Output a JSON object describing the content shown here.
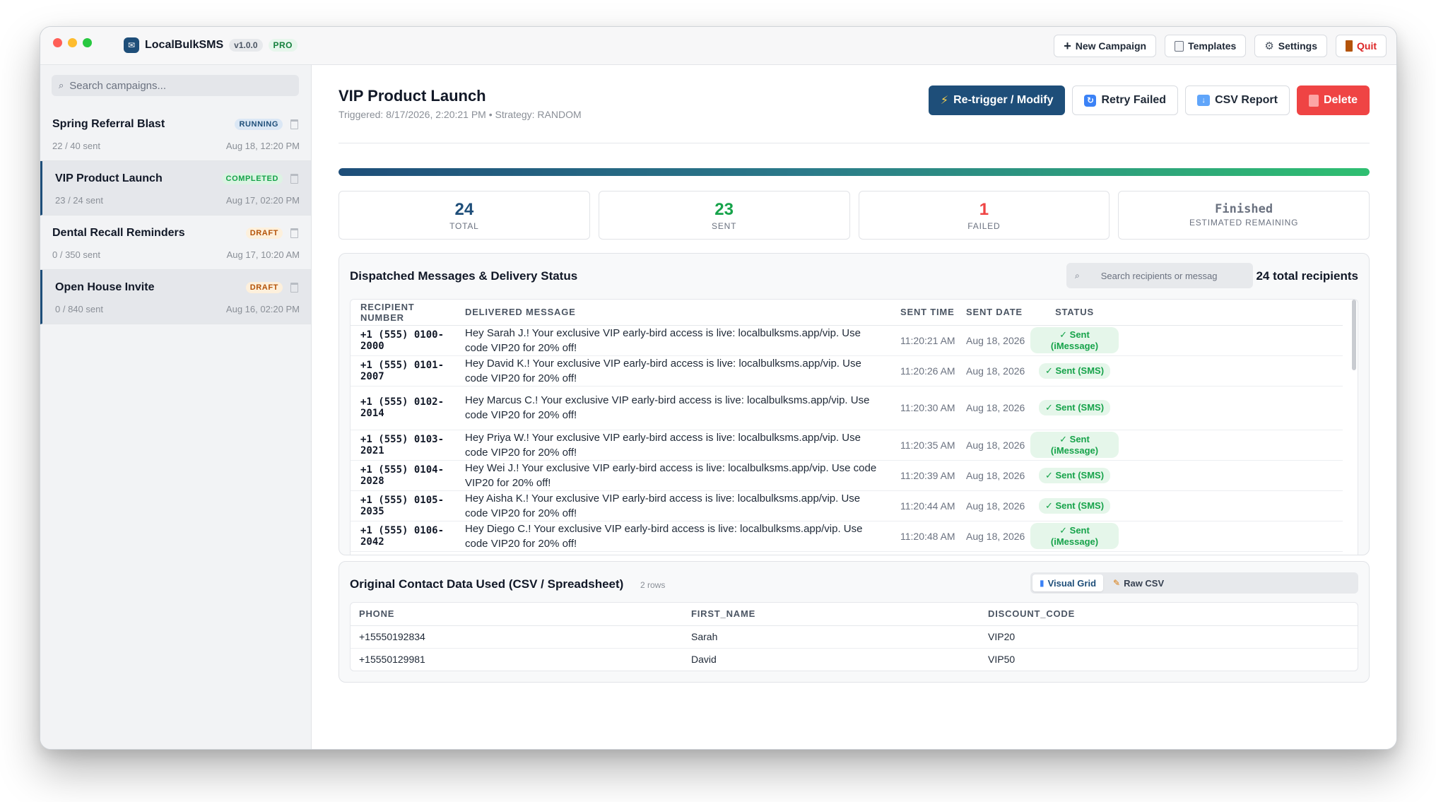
{
  "app": {
    "name": "LocalBulkSMS",
    "version": "v1.0.0",
    "tier": "PRO"
  },
  "topbar": {
    "new_campaign": "New Campaign",
    "templates": "Templates",
    "settings": "Settings",
    "quit": "Quit"
  },
  "sidebar": {
    "search_placeholder": "Search campaigns...",
    "campaigns": [
      {
        "name": "Spring Referral Blast",
        "status": "RUNNING",
        "sent": "22 / 40 sent",
        "date": "Aug 18, 12:20 PM"
      },
      {
        "name": "VIP Product Launch",
        "status": "COMPLETED",
        "sent": "23 / 24 sent",
        "date": "Aug 17, 02:20 PM"
      },
      {
        "name": "Dental Recall Reminders",
        "status": "DRAFT",
        "sent": "0 / 350 sent",
        "date": "Aug 17, 10:20 AM"
      },
      {
        "name": "Open House Invite",
        "status": "DRAFT",
        "sent": "0 / 840 sent",
        "date": "Aug 16, 02:20 PM"
      }
    ]
  },
  "campaign": {
    "title": "VIP Product Launch",
    "meta": "Triggered: 8/17/2026, 2:20:21 PM • Strategy: RANDOM",
    "actions": {
      "retrigger": "Re-trigger / Modify",
      "retry": "Retry Failed",
      "csv": "CSV Report",
      "delete": "Delete"
    },
    "progress": 1.0,
    "stats": [
      {
        "value": "24",
        "label": "TOTAL"
      },
      {
        "value": "23",
        "label": "SENT"
      },
      {
        "value": "1",
        "label": "FAILED"
      },
      {
        "value": "Finished",
        "label": "ESTIMATED REMAINING"
      }
    ]
  },
  "messages": {
    "title": "Dispatched Messages & Delivery Status",
    "search_placeholder": "Search recipients or messag",
    "total": "24 total recipients",
    "columns": [
      "RECIPIENT NUMBER",
      "DELIVERED MESSAGE",
      "SENT TIME",
      "SENT DATE",
      "STATUS"
    ],
    "rows": [
      {
        "number": "+1 (555) 0100-2000",
        "message": "Hey Sarah J.! Your exclusive VIP early-bird access is live: localbulksms.app/vip. Use code VIP20 for 20% off!",
        "time": "11:20:21 AM",
        "date": "Aug 18, 2026",
        "status": "✓ Sent (iMessage)"
      },
      {
        "number": "+1 (555) 0101-2007",
        "message": "Hey David K.! Your exclusive VIP early-bird access is live: localbulksms.app/vip. Use code VIP20 for 20% off!",
        "time": "11:20:26 AM",
        "date": "Aug 18, 2026",
        "status": "✓ Sent (SMS)"
      },
      {
        "number": "+1 (555) 0102-2014",
        "message": "Hey Marcus C.! Your exclusive VIP early-bird access is live: localbulksms.app/vip. Use code VIP20 for 20% off!",
        "time": "11:20:30 AM",
        "date": "Aug 18, 2026",
        "status": "✓ Sent (SMS)"
      },
      {
        "number": "+1 (555) 0103-2021",
        "message": "Hey Priya W.! Your exclusive VIP early-bird access is live: localbulksms.app/vip. Use code VIP20 for 20% off!",
        "time": "11:20:35 AM",
        "date": "Aug 18, 2026",
        "status": "✓ Sent (iMessage)"
      },
      {
        "number": "+1 (555) 0104-2028",
        "message": "Hey Wei J.! Your exclusive VIP early-bird access is live: localbulksms.app/vip. Use code VIP20 for 20% off!",
        "time": "11:20:39 AM",
        "date": "Aug 18, 2026",
        "status": "✓ Sent (SMS)"
      },
      {
        "number": "+1 (555) 0105-2035",
        "message": "Hey Aisha K.! Your exclusive VIP early-bird access is live: localbulksms.app/vip. Use code VIP20 for 20% off!",
        "time": "11:20:44 AM",
        "date": "Aug 18, 2026",
        "status": "✓ Sent (SMS)"
      },
      {
        "number": "+1 (555) 0106-2042",
        "message": "Hey Diego C.! Your exclusive VIP early-bird access is live: localbulksms.app/vip. Use code VIP20 for 20% off!",
        "time": "11:20:48 AM",
        "date": "Aug 18, 2026",
        "status": "✓ Sent (iMessage)"
      }
    ]
  },
  "contacts": {
    "title": "Original Contact Data Used (CSV / Spreadsheet)",
    "rows_count": "2 rows",
    "view_grid": "Visual Grid",
    "view_raw": "Raw CSV",
    "columns": [
      "PHONE",
      "FIRST_NAME",
      "DISCOUNT_CODE"
    ],
    "rows": [
      [
        "+15550192834",
        "Sarah",
        "VIP20"
      ],
      [
        "+15550129981",
        "David",
        "VIP50"
      ]
    ]
  },
  "colors": {
    "accent": "#1e4e79",
    "success": "#16a34a",
    "danger": "#ef4444",
    "warning": "#b45309"
  }
}
